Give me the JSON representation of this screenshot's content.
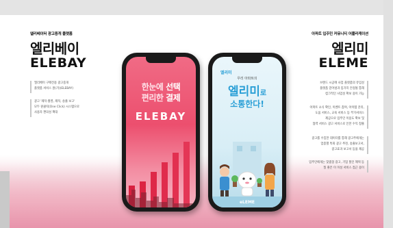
{
  "left": {
    "subtitle": "엘리베이터 광고중개 플랫폼",
    "title_kor": "엘리베이",
    "title_eng": "ELEBAY",
    "desc1": [
      "엘리베이 구매전용 광고중개",
      "플랫폼 서비스 원(가)(ELEBAY)"
    ],
    "desc2": [
      "광고 '제작·촬영, 제작, 송출 보고'",
      "모두 원클릭(One Click) 시스템으로",
      "사용자 편의성 확대"
    ]
  },
  "right": {
    "subtitle": "아파트 입주민 커뮤니티 어플리케이션",
    "title_kor": "엘리미",
    "title_eng": "ELEME",
    "desc1": [
      "브랜드 시공에 사업 플랫폼의 유입성",
      "플랫폼 얻어냄과 입가치 안정될 통해",
      "컴크적인 사업성 확보 용이 가능"
    ],
    "desc2": [
      "아파트 소식 확인, 이벤트 참여, 아이템 관리,",
      "도움 서비스, 교육 서비스 등 부가서비스",
      "제공으로 입주민 이용도 확보 및",
      "협력 서비스 광고 서비스로 인한 수익 창출"
    ],
    "desc3": [
      "광고를 수집한 데이터를 통해 광고주에게는",
      "업종별 특화 광고 추천, 송출보고서,",
      "광고효과 보고서 등을 제공"
    ],
    "desc4": [
      "입주민에게는 맞춤형 광고, 기업 할인 혜택 등",
      "질 좋은 이 이성 서비스 접근 용이"
    ]
  },
  "phone1": {
    "tagline1": "한눈에 ",
    "tagline1_em": "선택",
    "tagline2": "편리한 ",
    "tagline2_em": "결제",
    "brand": "ELEBAY"
  },
  "phone2": {
    "small1": "엘리미",
    "small2": "우리 아파트의",
    "headline": "엘리미",
    "headline_suffix": "로",
    "headline2": "소통한다!",
    "footer": "eLEME"
  },
  "colors": {
    "accent_pink": "#ec4f6e",
    "accent_blue": "#2a9fd6"
  }
}
